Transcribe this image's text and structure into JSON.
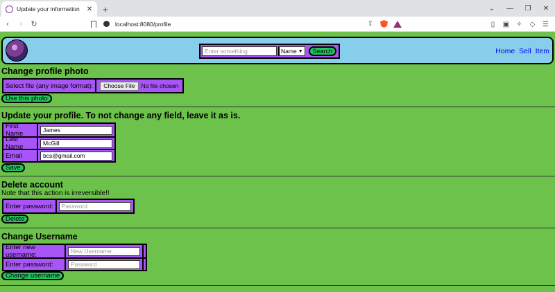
{
  "browser": {
    "tab_title": "Update your information",
    "url": "localhost:8080/profile"
  },
  "header": {
    "search_placeholder": "Enter something",
    "search_type": "Name",
    "search_button": "Search",
    "nav": [
      "Home",
      "Sell",
      "Item"
    ]
  },
  "photo": {
    "heading": "Change profile photo",
    "file_label": "Select file (any image format):",
    "choose_file": "Choose File",
    "no_file": "No file chosen",
    "button": "Use this photo"
  },
  "profile": {
    "heading": "Update your profile. To not change any field, leave it as is.",
    "first_name_label": "First Name",
    "first_name_value": "James",
    "last_name_label": "Last Name",
    "last_name_value": "McGill",
    "email_label": "Email",
    "email_value": "bcs@gmail.com",
    "button": "Save"
  },
  "delete": {
    "heading": "Delete account",
    "note": "Note that this action is irreversible!!",
    "password_label": "Enter password:",
    "password_placeholder": "Password",
    "button": "Delete"
  },
  "username": {
    "heading": "Change Username",
    "new_label": "Enter new username:",
    "new_placeholder": "New Username",
    "password_label": "Enter password:",
    "password_placeholder": "Password",
    "button": "Change username"
  },
  "colors": {
    "page_bg": "#6cc24a",
    "header_bg": "#87ceeb",
    "form_bg": "#a855f7",
    "button_bg": "#22c55e"
  }
}
